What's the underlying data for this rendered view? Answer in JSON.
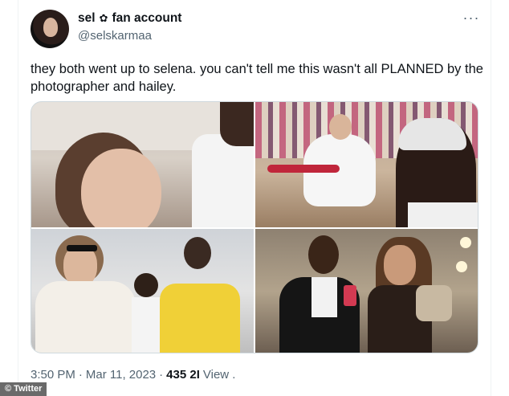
{
  "tweet": {
    "author": {
      "display_name": "sel",
      "name_emoji": "✿",
      "display_name_suffix": "fan account",
      "handle": "@selskarmaa"
    },
    "more_label": "···",
    "text": "they both went up to selena. you can't tell me this wasn't all PLANNED by the photographer and hailey.",
    "footer": {
      "time": "3:50 PM",
      "sep1": "·",
      "date": "Mar 11, 2023",
      "sep2": "·",
      "views_count": "435 2I",
      "views_label": "View ."
    }
  },
  "watermark": "© Twitter",
  "colors": {
    "text_primary": "#0f1419",
    "text_secondary": "#536471",
    "border": "#cfd9de"
  }
}
